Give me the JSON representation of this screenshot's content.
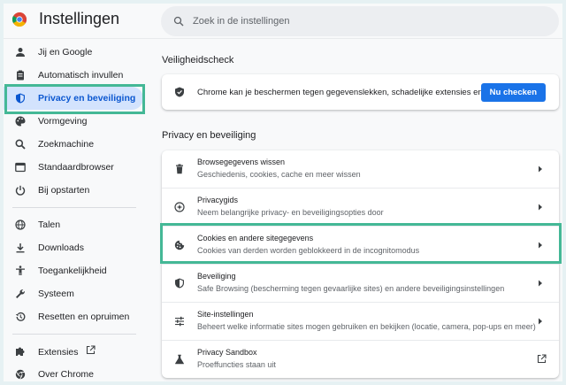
{
  "app": {
    "title": "Instellingen"
  },
  "search": {
    "placeholder": "Zoek in de instellingen",
    "value": ""
  },
  "sidebar": {
    "items": [
      {
        "label": "Jij en Google",
        "icon": "person-icon"
      },
      {
        "label": "Automatisch invullen",
        "icon": "clipboard-icon"
      },
      {
        "label": "Privacy en beveiliging",
        "icon": "shield-icon",
        "active": true
      },
      {
        "label": "Vormgeving",
        "icon": "palette-icon"
      },
      {
        "label": "Zoekmachine",
        "icon": "search-icon"
      },
      {
        "label": "Standaardbrowser",
        "icon": "browser-icon"
      },
      {
        "label": "Bij opstarten",
        "icon": "power-icon"
      },
      {
        "label": "Talen",
        "icon": "globe-icon"
      },
      {
        "label": "Downloads",
        "icon": "download-icon"
      },
      {
        "label": "Toegankelijkheid",
        "icon": "accessibility-icon"
      },
      {
        "label": "Systeem",
        "icon": "wrench-icon"
      },
      {
        "label": "Resetten en opruimen",
        "icon": "history-icon"
      },
      {
        "label": "Extensies",
        "icon": "puzzle-icon"
      },
      {
        "label": "Over Chrome",
        "icon": "chrome-icon"
      }
    ]
  },
  "safety_check": {
    "title": "Veiligheidscheck",
    "text": "Chrome kan je beschermen tegen gegevenslekken, schadelijke extensies en meer",
    "button": "Nu checken"
  },
  "privacy": {
    "title": "Privacy en beveiliging",
    "rows": [
      {
        "title": "Browsegegevens wissen",
        "subtitle": "Geschiedenis, cookies, cache en meer wissen",
        "icon": "trash-icon"
      },
      {
        "title": "Privacygids",
        "subtitle": "Neem belangrijke privacy- en beveiligingsopties door",
        "icon": "compass-icon"
      },
      {
        "title": "Cookies en andere sitegegevens",
        "subtitle": "Cookies van derden worden geblokkeerd in de incognitomodus",
        "icon": "cookie-icon"
      },
      {
        "title": "Beveiliging",
        "subtitle": "Safe Browsing (bescherming tegen gevaarlijke sites) en andere beveiligingsinstellingen",
        "icon": "shield-icon"
      },
      {
        "title": "Site-instellingen",
        "subtitle": "Beheert welke informatie sites mogen gebruiken en bekijken (locatie, camera, pop-ups en meer)",
        "icon": "sliders-icon"
      },
      {
        "title": "Privacy Sandbox",
        "subtitle": "Proeffuncties staan uit",
        "icon": "flask-icon"
      }
    ]
  },
  "colors": {
    "accent": "#1a73e8",
    "active_bg": "#d3e3fd",
    "highlight": "#44b896"
  }
}
